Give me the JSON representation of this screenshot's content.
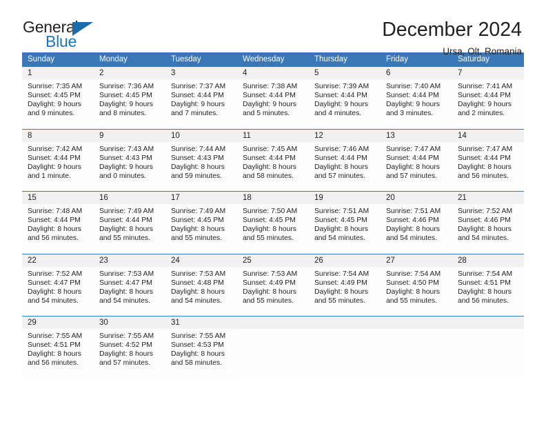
{
  "brand": {
    "word_top": "General",
    "word_bottom": "Blue",
    "triangle_color": "#1b6cab",
    "blue_color": "#1b75bb"
  },
  "header": {
    "title": "December 2024",
    "subtitle": "Ursa, Olt, Romania"
  },
  "theme": {
    "header_bg": "#3a77b6",
    "header_text": "#ffffff",
    "daynum_bg": "#f0f0f0",
    "cell_bg": "#fcfcfc",
    "text": "#231f20"
  },
  "calendar": {
    "weekday_headers": [
      "Sunday",
      "Monday",
      "Tuesday",
      "Wednesday",
      "Thursday",
      "Friday",
      "Saturday"
    ],
    "labels": {
      "sunrise": "Sunrise:",
      "sunset": "Sunset:",
      "daylight": "Daylight:"
    },
    "weeks": [
      [
        {
          "day": "1",
          "sunrise": "Sunrise: 7:35 AM",
          "sunset": "Sunset: 4:45 PM",
          "daylight1": "Daylight: 9 hours",
          "daylight2": "and 9 minutes."
        },
        {
          "day": "2",
          "sunrise": "Sunrise: 7:36 AM",
          "sunset": "Sunset: 4:45 PM",
          "daylight1": "Daylight: 9 hours",
          "daylight2": "and 8 minutes."
        },
        {
          "day": "3",
          "sunrise": "Sunrise: 7:37 AM",
          "sunset": "Sunset: 4:44 PM",
          "daylight1": "Daylight: 9 hours",
          "daylight2": "and 7 minutes."
        },
        {
          "day": "4",
          "sunrise": "Sunrise: 7:38 AM",
          "sunset": "Sunset: 4:44 PM",
          "daylight1": "Daylight: 9 hours",
          "daylight2": "and 5 minutes."
        },
        {
          "day": "5",
          "sunrise": "Sunrise: 7:39 AM",
          "sunset": "Sunset: 4:44 PM",
          "daylight1": "Daylight: 9 hours",
          "daylight2": "and 4 minutes."
        },
        {
          "day": "6",
          "sunrise": "Sunrise: 7:40 AM",
          "sunset": "Sunset: 4:44 PM",
          "daylight1": "Daylight: 9 hours",
          "daylight2": "and 3 minutes."
        },
        {
          "day": "7",
          "sunrise": "Sunrise: 7:41 AM",
          "sunset": "Sunset: 4:44 PM",
          "daylight1": "Daylight: 9 hours",
          "daylight2": "and 2 minutes."
        }
      ],
      [
        {
          "day": "8",
          "sunrise": "Sunrise: 7:42 AM",
          "sunset": "Sunset: 4:44 PM",
          "daylight1": "Daylight: 9 hours",
          "daylight2": "and 1 minute."
        },
        {
          "day": "9",
          "sunrise": "Sunrise: 7:43 AM",
          "sunset": "Sunset: 4:43 PM",
          "daylight1": "Daylight: 9 hours",
          "daylight2": "and 0 minutes."
        },
        {
          "day": "10",
          "sunrise": "Sunrise: 7:44 AM",
          "sunset": "Sunset: 4:43 PM",
          "daylight1": "Daylight: 8 hours",
          "daylight2": "and 59 minutes."
        },
        {
          "day": "11",
          "sunrise": "Sunrise: 7:45 AM",
          "sunset": "Sunset: 4:44 PM",
          "daylight1": "Daylight: 8 hours",
          "daylight2": "and 58 minutes."
        },
        {
          "day": "12",
          "sunrise": "Sunrise: 7:46 AM",
          "sunset": "Sunset: 4:44 PM",
          "daylight1": "Daylight: 8 hours",
          "daylight2": "and 57 minutes."
        },
        {
          "day": "13",
          "sunrise": "Sunrise: 7:47 AM",
          "sunset": "Sunset: 4:44 PM",
          "daylight1": "Daylight: 8 hours",
          "daylight2": "and 57 minutes."
        },
        {
          "day": "14",
          "sunrise": "Sunrise: 7:47 AM",
          "sunset": "Sunset: 4:44 PM",
          "daylight1": "Daylight: 8 hours",
          "daylight2": "and 56 minutes."
        }
      ],
      [
        {
          "day": "15",
          "sunrise": "Sunrise: 7:48 AM",
          "sunset": "Sunset: 4:44 PM",
          "daylight1": "Daylight: 8 hours",
          "daylight2": "and 56 minutes."
        },
        {
          "day": "16",
          "sunrise": "Sunrise: 7:49 AM",
          "sunset": "Sunset: 4:44 PM",
          "daylight1": "Daylight: 8 hours",
          "daylight2": "and 55 minutes."
        },
        {
          "day": "17",
          "sunrise": "Sunrise: 7:49 AM",
          "sunset": "Sunset: 4:45 PM",
          "daylight1": "Daylight: 8 hours",
          "daylight2": "and 55 minutes."
        },
        {
          "day": "18",
          "sunrise": "Sunrise: 7:50 AM",
          "sunset": "Sunset: 4:45 PM",
          "daylight1": "Daylight: 8 hours",
          "daylight2": "and 55 minutes."
        },
        {
          "day": "19",
          "sunrise": "Sunrise: 7:51 AM",
          "sunset": "Sunset: 4:45 PM",
          "daylight1": "Daylight: 8 hours",
          "daylight2": "and 54 minutes."
        },
        {
          "day": "20",
          "sunrise": "Sunrise: 7:51 AM",
          "sunset": "Sunset: 4:46 PM",
          "daylight1": "Daylight: 8 hours",
          "daylight2": "and 54 minutes."
        },
        {
          "day": "21",
          "sunrise": "Sunrise: 7:52 AM",
          "sunset": "Sunset: 4:46 PM",
          "daylight1": "Daylight: 8 hours",
          "daylight2": "and 54 minutes."
        }
      ],
      [
        {
          "day": "22",
          "sunrise": "Sunrise: 7:52 AM",
          "sunset": "Sunset: 4:47 PM",
          "daylight1": "Daylight: 8 hours",
          "daylight2": "and 54 minutes."
        },
        {
          "day": "23",
          "sunrise": "Sunrise: 7:53 AM",
          "sunset": "Sunset: 4:47 PM",
          "daylight1": "Daylight: 8 hours",
          "daylight2": "and 54 minutes."
        },
        {
          "day": "24",
          "sunrise": "Sunrise: 7:53 AM",
          "sunset": "Sunset: 4:48 PM",
          "daylight1": "Daylight: 8 hours",
          "daylight2": "and 54 minutes."
        },
        {
          "day": "25",
          "sunrise": "Sunrise: 7:53 AM",
          "sunset": "Sunset: 4:49 PM",
          "daylight1": "Daylight: 8 hours",
          "daylight2": "and 55 minutes."
        },
        {
          "day": "26",
          "sunrise": "Sunrise: 7:54 AM",
          "sunset": "Sunset: 4:49 PM",
          "daylight1": "Daylight: 8 hours",
          "daylight2": "and 55 minutes."
        },
        {
          "day": "27",
          "sunrise": "Sunrise: 7:54 AM",
          "sunset": "Sunset: 4:50 PM",
          "daylight1": "Daylight: 8 hours",
          "daylight2": "and 55 minutes."
        },
        {
          "day": "28",
          "sunrise": "Sunrise: 7:54 AM",
          "sunset": "Sunset: 4:51 PM",
          "daylight1": "Daylight: 8 hours",
          "daylight2": "and 56 minutes."
        }
      ],
      [
        {
          "day": "29",
          "sunrise": "Sunrise: 7:55 AM",
          "sunset": "Sunset: 4:51 PM",
          "daylight1": "Daylight: 8 hours",
          "daylight2": "and 56 minutes."
        },
        {
          "day": "30",
          "sunrise": "Sunrise: 7:55 AM",
          "sunset": "Sunset: 4:52 PM",
          "daylight1": "Daylight: 8 hours",
          "daylight2": "and 57 minutes."
        },
        {
          "day": "31",
          "sunrise": "Sunrise: 7:55 AM",
          "sunset": "Sunset: 4:53 PM",
          "daylight1": "Daylight: 8 hours",
          "daylight2": "and 58 minutes."
        },
        {
          "day": "",
          "sunrise": "",
          "sunset": "",
          "daylight1": "",
          "daylight2": ""
        },
        {
          "day": "",
          "sunrise": "",
          "sunset": "",
          "daylight1": "",
          "daylight2": ""
        },
        {
          "day": "",
          "sunrise": "",
          "sunset": "",
          "daylight1": "",
          "daylight2": ""
        },
        {
          "day": "",
          "sunrise": "",
          "sunset": "",
          "daylight1": "",
          "daylight2": ""
        }
      ]
    ]
  }
}
